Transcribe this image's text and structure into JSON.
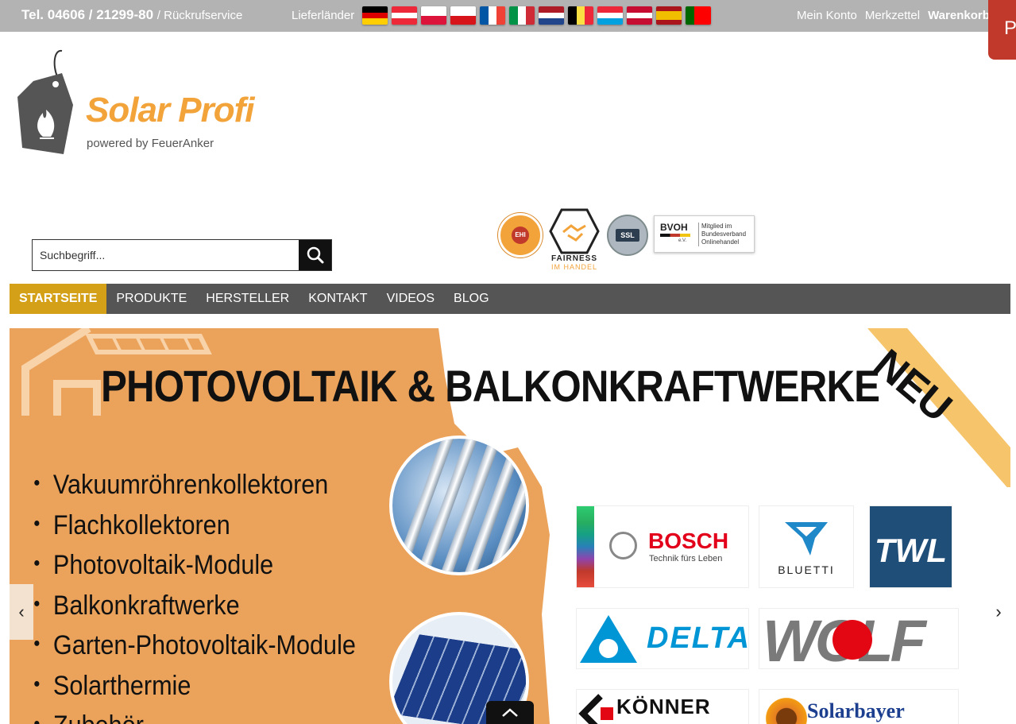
{
  "topbar": {
    "phone": "Tel. 04606 / 21299-80",
    "callback": "/ Rückrufservice",
    "delivery_label": "Lieferländer",
    "flags": [
      {
        "name": "germany-flag",
        "dir": "h",
        "colors": [
          "#000000",
          "#dd0000",
          "#ffce00"
        ]
      },
      {
        "name": "austria-flag",
        "dir": "h",
        "colors": [
          "#ed2939",
          "#ffffff",
          "#ed2939"
        ]
      },
      {
        "name": "poland-flag",
        "dir": "h",
        "colors": [
          "#ffffff",
          "#dc143c"
        ]
      },
      {
        "name": "czech-flag",
        "dir": "h",
        "colors": [
          "#ffffff",
          "#d7141a"
        ]
      },
      {
        "name": "france-flag",
        "dir": "v",
        "colors": [
          "#0055a4",
          "#ffffff",
          "#ef4135"
        ]
      },
      {
        "name": "italy-flag",
        "dir": "v",
        "colors": [
          "#009246",
          "#ffffff",
          "#ce2b37"
        ]
      },
      {
        "name": "netherlands-flag",
        "dir": "h",
        "colors": [
          "#ae1c28",
          "#ffffff",
          "#21468b"
        ]
      },
      {
        "name": "belgium-flag",
        "dir": "v",
        "colors": [
          "#000000",
          "#fae042",
          "#ed2939"
        ]
      },
      {
        "name": "luxembourg-flag",
        "dir": "h",
        "colors": [
          "#ed2939",
          "#ffffff",
          "#00a1de"
        ]
      },
      {
        "name": "denmark-flag",
        "dir": "h",
        "colors": [
          "#c60c30",
          "#ffffff",
          "#c60c30"
        ]
      },
      {
        "name": "spain-flag",
        "dir": "h",
        "colors": [
          "#aa151b",
          "#f1bf00",
          "#f1bf00",
          "#aa151b"
        ]
      },
      {
        "name": "portugal-flag",
        "dir": "v",
        "colors": [
          "#006600",
          "#ff0000",
          "#ff0000"
        ]
      }
    ],
    "links": {
      "account": "Mein Konto",
      "wishlist": "Merkzettel",
      "cart": "Warenkorb"
    },
    "tab_letter": "P"
  },
  "logo": {
    "brand": "Solar Profi",
    "powered": "powered by FeuerAnker"
  },
  "search": {
    "placeholder": "Suchbegriff..."
  },
  "badges": {
    "ehi": "EHI",
    "fairness": "FAIRNESS",
    "fairness_sub": "IM HANDEL",
    "ssl": "SSL",
    "bvoh": "BVOH",
    "bvoh_sub": "e.V.",
    "bvoh_text": "Mitglied im Bundesverband Onlinehandel"
  },
  "nav": {
    "items": [
      "STARTSEITE",
      "PRODUKTE",
      "HERSTELLER",
      "KONTAKT",
      "VIDEOS",
      "BLOG"
    ]
  },
  "banner": {
    "headline": "PHOTOVOLTAIK & BALKONKRAFTWERKE",
    "ribbon": "NEU",
    "list": [
      "Vakuumröhrenkollektoren",
      "Flachkollektoren",
      "Photovoltaik-Module",
      "Balkonkraftwerke",
      "Garten-Photovoltaik-Module",
      "Solarthermie",
      "Zubehör"
    ],
    "brands": {
      "bosch": "BOSCH",
      "bosch_tag": "Technik fürs Leben",
      "bluetti": "BLUETTI",
      "twl": "TWL",
      "delta": "DELTA",
      "wolf": "WOLF",
      "koenner": "KÖNNER",
      "solarbayer": "Solarbayer"
    },
    "prev": "‹",
    "next": "›"
  }
}
